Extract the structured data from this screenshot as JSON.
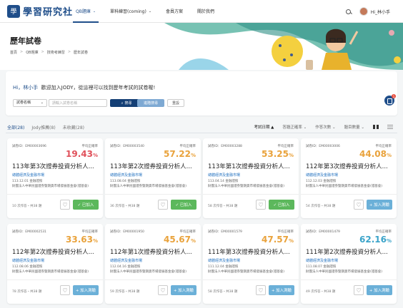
{
  "nav": {
    "logo_text": "學習研究社",
    "items": [
      {
        "label": "QB題庫",
        "caret": "⌄"
      },
      {
        "label": "單科練習(coming)",
        "caret": "⌄"
      },
      {
        "label": "會員方案",
        "caret": ""
      },
      {
        "label": "關於我們",
        "caret": ""
      }
    ],
    "user": "Hi_林小手"
  },
  "hero": {
    "title": "歷年試卷",
    "breadcrumbs": [
      "首頁",
      "QB題庫",
      "技術考練習",
      "歷年試卷"
    ]
  },
  "search": {
    "greeting_name": "Hi，林小手",
    "greeting_text": "歡迎加入JODY，從這裡可以找到歷年考試的試卷喔!",
    "select_value": "試卷名稱",
    "input_placeholder": "請輸入試卷名稱",
    "search_label": "搜尋",
    "advanced_label": "進階搜尋",
    "reset_label": "重設",
    "fab_badge": "1"
  },
  "tabs": [
    {
      "label": "全部",
      "count": "(28)"
    },
    {
      "label": "Jody推薦",
      "count": "(8)"
    },
    {
      "label": "未收藏",
      "count": "(28)"
    }
  ],
  "sorts": [
    "考試日期 ▲",
    "答題正確率 ⌄",
    "作答次數 ⌄",
    "題目數量 ⌄"
  ],
  "cards": [
    {
      "id": "試卷ID：EM00003696",
      "rate_label": "平均正確率",
      "rate": "19.43",
      "pct": "%",
      "color": "#e0515b",
      "title": "113年第3次證券投資分析人...",
      "subject": "總體經濟及金融市場",
      "date": "113.12.01 金融證照",
      "org": "財團法人中華民國證券暨期貨市場發展基金會(證基會)",
      "stats": "10 次作答・共38 題",
      "action": "✓ 已加入",
      "added": true
    },
    {
      "id": "試卷ID：EM00003540",
      "rate_label": "平均正確率",
      "rate": "57.22",
      "pct": "%",
      "color": "#e9a23b",
      "title": "113年第2次證券投資分析人...",
      "subject": "總體經濟及金融市場",
      "date": "113.08.04 金融證照",
      "org": "財團法人中華民國證券暨期貨市場發展基金會(證基會)",
      "stats": "36 次作答・共38 題",
      "action": "✓ 已加入",
      "added": true
    },
    {
      "id": "試卷ID：EM00003288",
      "rate_label": "平均正確率",
      "rate": "53.25",
      "pct": "%",
      "color": "#e9a23b",
      "title": "113年第1次證券投資分析人...",
      "subject": "總體經濟及金融市場",
      "date": "113.04.14 金融證照",
      "org": "財團法人中華民國證券暨期貨市場發展基金會(證基會)",
      "stats": "58 次作答・共38 題",
      "action": "✓ 已加入",
      "added": true
    },
    {
      "id": "試卷ID：EM00003006",
      "rate_label": "平均正確率",
      "rate": "44.08",
      "pct": "%",
      "color": "#e9a23b",
      "title": "112年第3次證券投資分析人...",
      "subject": "總體經濟及金融市場",
      "date": "112.12.03 金融證照",
      "org": "財團法人中華民國證券暨期貨市場發展基金會(證基會)",
      "stats": "54 次作答・共38 題",
      "action": "+ 加入測驗",
      "added": false
    },
    {
      "id": "試卷ID：EM00002531",
      "rate_label": "平均正確率",
      "rate": "33.63",
      "pct": "%",
      "color": "#e9a23b",
      "title": "112年第2次證券投資分析人...",
      "subject": "總體經濟及金融市場",
      "date": "112.08.06 金融證照",
      "org": "財團法人中華民國證券暨期貨市場發展基金會(證基會)",
      "stats": "78 次作答・共38 題",
      "action": "+ 加入測驗",
      "added": false
    },
    {
      "id": "試卷ID：EM00001950",
      "rate_label": "平均正確率",
      "rate": "45.67",
      "pct": "%",
      "color": "#e9a23b",
      "title": "112年第1次證券投資分析人...",
      "subject": "總體經濟及金融市場",
      "date": "112.04.16 金融證照",
      "org": "財團法人中華民國證券暨期貨市場發展基金會(證基會)",
      "stats": "59 次作答・共38 題",
      "action": "+ 加入測驗",
      "added": false
    },
    {
      "id": "試卷ID：EM00001579",
      "rate_label": "平均正確率",
      "rate": "47.57",
      "pct": "%",
      "color": "#e9a23b",
      "title": "111年第3次證券投資分析人...",
      "subject": "總體經濟及金融市場",
      "date": "111.12.04 金融證照",
      "org": "財團法人中華民國證券暨期貨市場發展基金會(證基會)",
      "stats": "58 次作答・共38 題",
      "action": "+ 加入測驗",
      "added": false
    },
    {
      "id": "試卷ID：EM00001479",
      "rate_label": "平均正確率",
      "rate": "62.16",
      "pct": "%",
      "color": "#3aa3c9",
      "title": "111年第2次證券投資分析人...",
      "subject": "總體經濟及金融市場",
      "date": "111.08.07 金融證照",
      "org": "財團法人中華民國證券暨期貨市場發展基金會(證基會)",
      "stats": "49 次作答・共38 題",
      "action": "+ 加入測驗",
      "added": false
    }
  ]
}
